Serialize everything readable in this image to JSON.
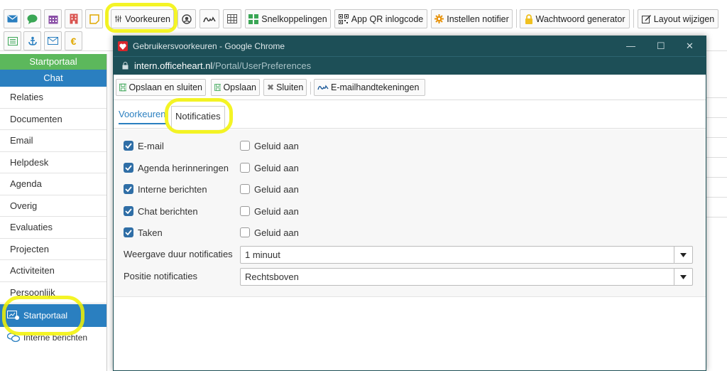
{
  "toolbar": {
    "voorkeuren": "Voorkeuren",
    "snelkoppelingen": "Snelkoppelingen",
    "app_qr": "App QR inlogcode",
    "notifier": "Instellen notifier",
    "wachtwoord": "Wachtwoord generator",
    "layout": "Layout wijzigen"
  },
  "sidebar": {
    "header1": "Startportaal",
    "header2": "Chat",
    "items": [
      "Relaties",
      "Documenten",
      "Email",
      "Helpdesk",
      "Agenda",
      "Overig",
      "Evaluaties",
      "Projecten",
      "Activiteiten",
      "Persoonlijk"
    ],
    "active": "Startportaal",
    "sub": "Interne berichten"
  },
  "window": {
    "title": "Gebruikersvoorkeuren - Google Chrome",
    "url_domain": "intern.officeheart.nl",
    "url_path": "/Portal/UserPreferences",
    "buttons": {
      "save_close": "Opslaan en sluiten",
      "save": "Opslaan",
      "close": "Sluiten",
      "signatures": "E-mailhandtekeningen"
    },
    "tabs": {
      "voorkeuren": "Voorkeuren",
      "notificaties": "Notificaties"
    }
  },
  "notifications": {
    "rows": [
      {
        "label": "E-mail",
        "checked": true,
        "sound": "Geluid aan"
      },
      {
        "label": "Agenda herinneringen",
        "checked": true,
        "sound": "Geluid aan"
      },
      {
        "label": "Interne berichten",
        "checked": true,
        "sound": "Geluid aan"
      },
      {
        "label": "Chat berichten",
        "checked": true,
        "sound": "Geluid aan"
      },
      {
        "label": "Taken",
        "checked": true,
        "sound": "Geluid aan"
      }
    ],
    "duration_label": "Weergave duur notificaties",
    "duration_value": "1 minuut",
    "position_label": "Positie notificaties",
    "position_value": "Rechtsboven"
  },
  "colors": {
    "accent_blue": "#2a7fc0",
    "green_header": "#5cb85c",
    "title_bar": "#1d4f57",
    "highlight": "#f2f200"
  }
}
